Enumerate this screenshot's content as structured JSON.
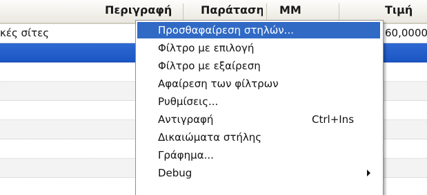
{
  "grid": {
    "columns": [
      {
        "label": "Περιγραφή"
      },
      {
        "label": "Παράταση"
      },
      {
        "label": "ΜΜ"
      },
      {
        "label": "Τιμή"
      }
    ],
    "rows": [
      {
        "description": "κές σίτες",
        "price": "60,0000",
        "selected": false
      },
      {
        "description": "",
        "price": "",
        "selected": true
      },
      {
        "description": "",
        "price": "",
        "selected": false
      },
      {
        "description": "",
        "price": "",
        "selected": false
      },
      {
        "description": "",
        "price": "",
        "selected": false
      },
      {
        "description": "",
        "price": "",
        "selected": false
      },
      {
        "description": "",
        "price": "",
        "selected": false
      },
      {
        "description": "",
        "price": "",
        "selected": false
      },
      {
        "description": "",
        "price": "",
        "selected": false
      }
    ]
  },
  "context_menu": {
    "items": [
      {
        "label": "Προσθαφαίρεση στηλών...",
        "shortcut": "",
        "submenu": false,
        "highlighted": true
      },
      {
        "label": "Φίλτρο με επιλογή",
        "shortcut": "",
        "submenu": false,
        "highlighted": false
      },
      {
        "label": "Φίλτρο με εξαίρεση",
        "shortcut": "",
        "submenu": false,
        "highlighted": false
      },
      {
        "label": "Αφαίρεση των φίλτρων",
        "shortcut": "",
        "submenu": false,
        "highlighted": false
      },
      {
        "label": "Ρυθμίσεις...",
        "shortcut": "",
        "submenu": false,
        "highlighted": false
      },
      {
        "label": "Αντιγραφή",
        "shortcut": "Ctrl+Ins",
        "submenu": false,
        "highlighted": false
      },
      {
        "label": "Δικαιώματα στήλης",
        "shortcut": "",
        "submenu": false,
        "highlighted": false
      },
      {
        "label": "Γράφημα...",
        "shortcut": "",
        "submenu": false,
        "highlighted": false
      },
      {
        "label": "Debug",
        "shortcut": "",
        "submenu": true,
        "highlighted": false
      }
    ]
  },
  "colors": {
    "selection_row": "#1b55c4",
    "menu_highlight": "#316ac5"
  }
}
